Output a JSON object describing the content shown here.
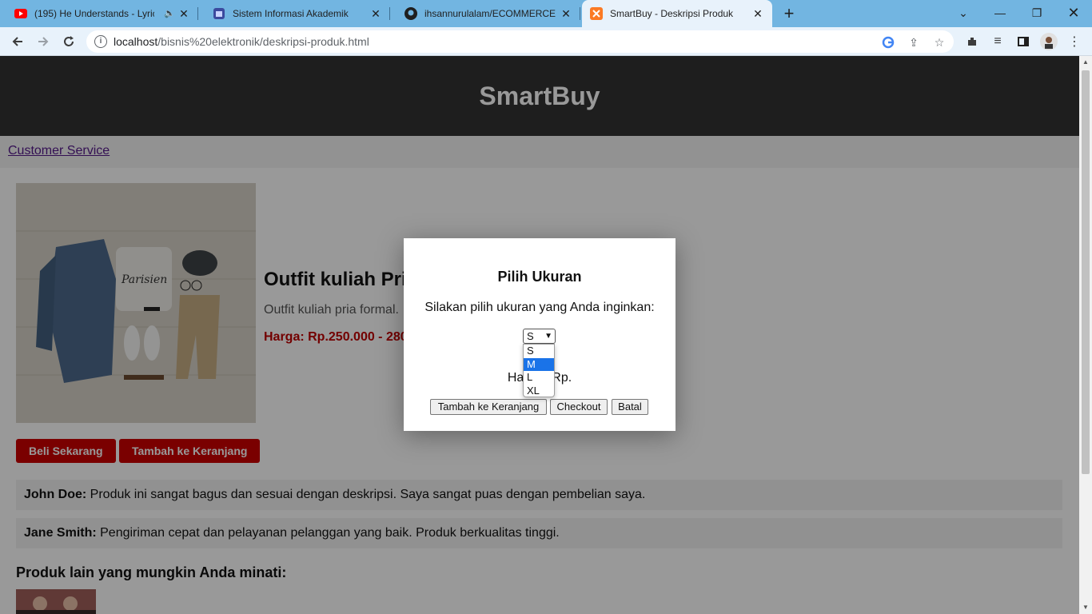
{
  "browser": {
    "tabs": [
      {
        "title": "(195) He Understands - Lyric",
        "favicon": "youtube-icon"
      },
      {
        "title": "Sistem Informasi Akademik",
        "favicon": "academic-icon"
      },
      {
        "title": "ihsannurulalam/ECOMMERCE",
        "favicon": "github-icon"
      },
      {
        "title": "SmartBuy - Deskripsi Produk",
        "favicon": "xampp-icon"
      }
    ],
    "url_host": "localhost",
    "url_path": "/bisnis%20elektronik/deskripsi-produk.html"
  },
  "site": {
    "brand": "SmartBuy",
    "nav_link": "Customer Service"
  },
  "product": {
    "title": "Outfit kuliah Pri",
    "description": "Outfit kuliah pria formal. ",
    "price": "Harga: Rp.250.000 - 280",
    "buy_now": "Beli Sekarang",
    "add_to_cart": "Tambah ke Keranjang"
  },
  "reviews": [
    {
      "name": "John Doe:",
      "text": " Produk ini sangat bagus dan sesuai dengan deskripsi. Saya sangat puas dengan pembelian saya."
    },
    {
      "name": "Jane Smith:",
      "text": " Pengiriman cepat dan pelayanan pelanggan yang baik. Produk berkualitas tinggi."
    }
  ],
  "others_title": "Produk lain yang mungkin Anda minati:",
  "modal": {
    "title": "Pilih Ukuran",
    "message": "Silakan pilih ukuran yang Anda inginkan:",
    "selected_size": "S",
    "options": [
      "S",
      "M",
      "L",
      "XL"
    ],
    "highlighted_option": "M",
    "harga_left": "Ha",
    "harga_right": "Rp.",
    "btn_cart": "Tambah ke Keranjang",
    "btn_checkout": "Checkout",
    "btn_cancel": "Batal"
  },
  "colors": {
    "header_bg": "#333333",
    "accent_red": "#cc0000",
    "tab_strip": "#72b5e1"
  }
}
